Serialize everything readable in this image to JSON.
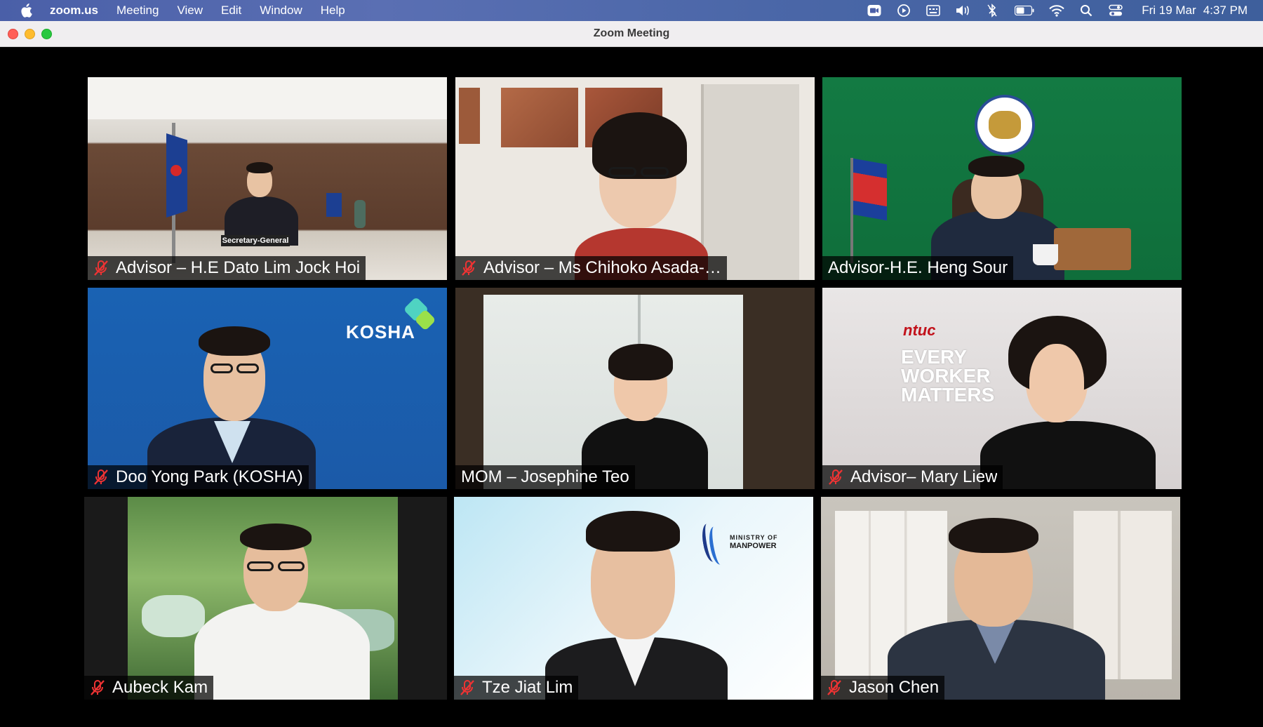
{
  "menubar": {
    "app_name": "zoom.us",
    "menus": [
      "Meeting",
      "View",
      "Edit",
      "Window",
      "Help"
    ],
    "date": "Fri 19 Mar",
    "time": "4:37 PM"
  },
  "window": {
    "title": "Zoom Meeting"
  },
  "tiles": [
    {
      "name": "Advisor – H.E Dato Lim Jock Hoi",
      "muted": true,
      "placard": "Secretary-General"
    },
    {
      "name": "Advisor – Ms Chihoko Asada-…",
      "muted": true
    },
    {
      "name": "Advisor-H.E. Heng Sour",
      "muted": false
    },
    {
      "name": "Doo Yong Park (KOSHA)",
      "muted": true,
      "logo": "KOSHA"
    },
    {
      "name": "MOM – Josephine Teo",
      "muted": false
    },
    {
      "name": "Advisor– Mary Liew",
      "muted": true,
      "logo": "ntuc",
      "slogan": [
        "EVERY",
        "WORKER",
        "MATTERS"
      ]
    },
    {
      "name": "Aubeck Kam",
      "muted": true
    },
    {
      "name": "Tze Jiat Lim",
      "muted": true,
      "logo_lines": [
        "MINISTRY OF",
        "MANPOWER"
      ]
    },
    {
      "name": "Jason Chen",
      "muted": true
    }
  ]
}
